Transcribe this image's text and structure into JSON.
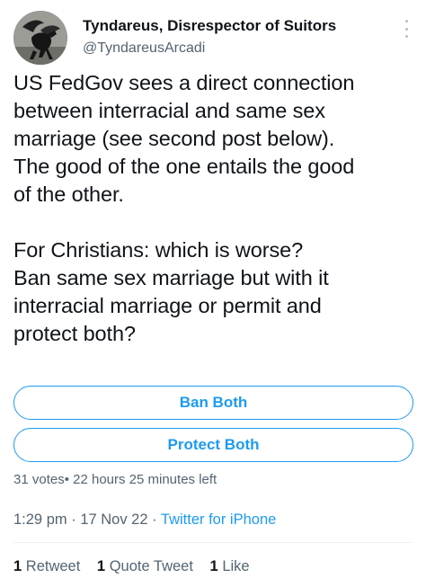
{
  "author": {
    "display_name": "Tyndareus, Disrespector of Suitors",
    "handle": "@TyndareusArcadi"
  },
  "tweet": {
    "paragraph1": "US FedGov sees a direct connection\nbetween interracial and same sex\nmarriage (see second post below).\nThe good of the one entails the good\nof the other.",
    "paragraph2": "For Christians: which is worse?\nBan same sex marriage but with it\ninterracial marriage or permit and\nprotect both?"
  },
  "poll": {
    "options": [
      "Ban Both",
      "Protect Both"
    ],
    "meta": "31 votes• 22 hours 25 minutes left"
  },
  "meta": {
    "time": "1:29 pm",
    "separator": "·",
    "date": "17 Nov 22",
    "source": "Twitter for iPhone"
  },
  "stats": {
    "retweets_count": "1",
    "retweets_label": "Retweet",
    "quotes_count": "1",
    "quotes_label": "Quote Tweet",
    "likes_count": "1",
    "likes_label": "Like"
  },
  "colors": {
    "accent": "#1d9bf0",
    "text": "#0f1419",
    "secondary": "#536471"
  },
  "icons": {
    "more": "more-icon",
    "avatar": "pegasus-avatar"
  }
}
